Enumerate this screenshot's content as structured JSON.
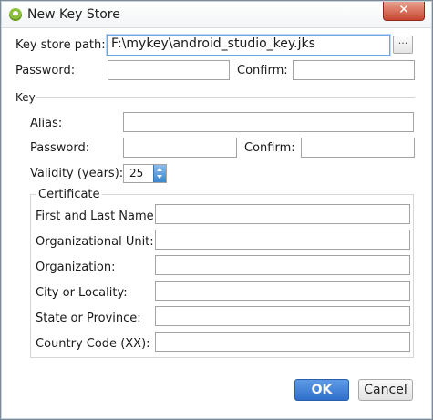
{
  "window": {
    "title": "New Key Store",
    "close_label": "✕"
  },
  "keystore": {
    "path_label": "Key store path:",
    "path_value": "F:\\mykey\\android_studio_key.jks",
    "browse_label": "···",
    "password_label": "Password:",
    "password_value": "",
    "confirm_label": "Confirm:",
    "confirm_value": ""
  },
  "key": {
    "section_label": "Key",
    "alias_label": "Alias:",
    "alias_value": "",
    "password_label": "Password:",
    "password_value": "",
    "confirm_label": "Confirm:",
    "confirm_value": "",
    "validity_label": "Validity (years):",
    "validity_value": "25"
  },
  "certificate": {
    "group_label": "Certificate",
    "first_last_label": "First and Last Name:",
    "org_unit_label": "Organizational Unit:",
    "organization_label": "Organization:",
    "city_label": "City or Locality:",
    "state_label": "State or Province:",
    "country_label": "Country Code (XX):",
    "first_last_value": "",
    "org_unit_value": "",
    "organization_value": "",
    "city_value": "",
    "state_value": "",
    "country_value": ""
  },
  "buttons": {
    "ok_label": "OK",
    "cancel_label": "Cancel"
  },
  "colors": {
    "accent": "#2f6fcc",
    "close": "#c8452f",
    "android_green": "#8bbf3c"
  }
}
